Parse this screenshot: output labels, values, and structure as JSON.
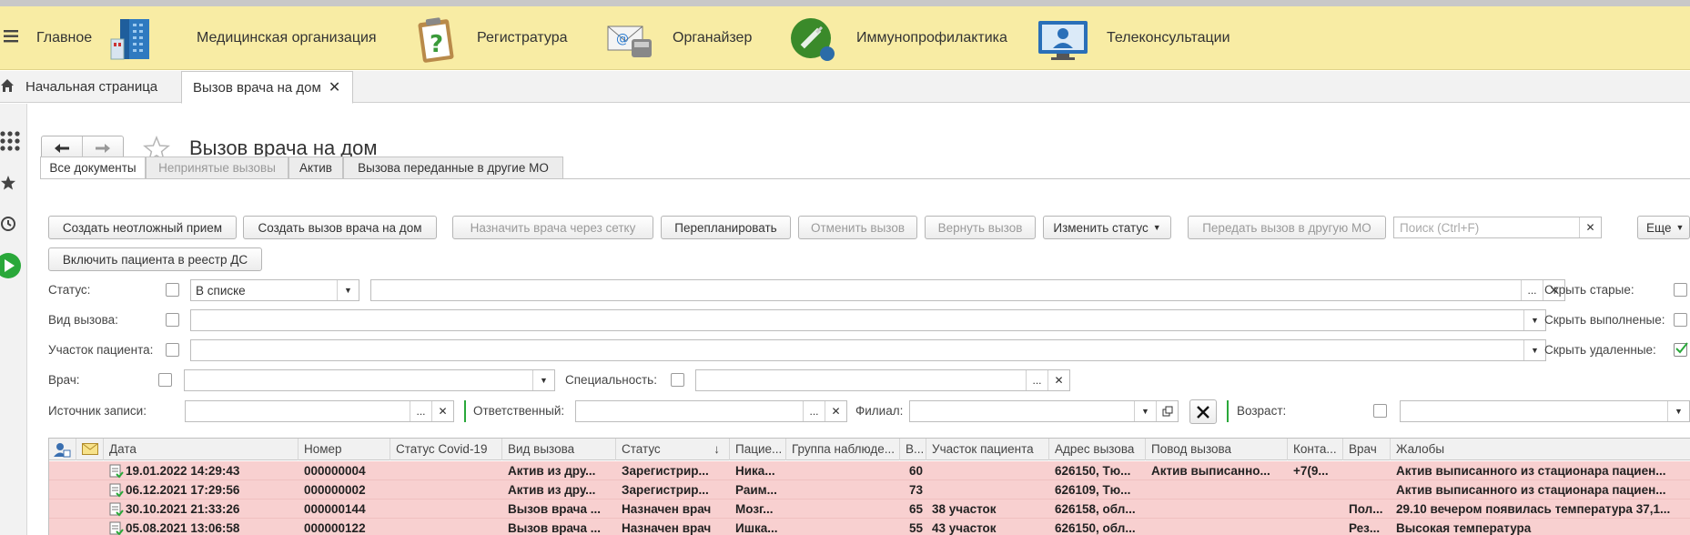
{
  "nav": {
    "items": [
      {
        "label": "Главное",
        "icon": "menu-icon"
      },
      {
        "label": "Медицинская организация",
        "icon": "hospital-building-icon"
      },
      {
        "label": "Регистратура",
        "icon": "clipboard-question-icon"
      },
      {
        "label": "Органайзер",
        "icon": "mail-phone-icon"
      },
      {
        "label": "Иммунопрофилактика",
        "icon": "syringe-icon"
      },
      {
        "label": "Телеконсультации",
        "icon": "operator-monitor-icon"
      }
    ]
  },
  "page_tabs": [
    {
      "label": "Начальная страница",
      "icon": "home-icon"
    },
    {
      "label": "Вызов врача на дом",
      "active": true
    }
  ],
  "form": {
    "title": "Вызов врача на дом",
    "filter_tabs": [
      "Все документы",
      "Непринятые вызовы",
      "Актив",
      "Вызова переданные в другие МО"
    ],
    "toolbar": {
      "create_urgent": "Создать неотложный прием",
      "create_home_call": "Создать вызов врача на дом",
      "assign_doctor": "Назначить врача через сетку",
      "reschedule": "Перепланировать",
      "cancel_call": "Отменить вызов",
      "return_call": "Вернуть вызов",
      "change_status": "Изменить статус",
      "transfer": "Передать вызов в другую МО",
      "search_placeholder": "Поиск (Ctrl+F)",
      "more": "Еще",
      "include_registry": "Включить пациента в реестр ДС"
    },
    "filters": {
      "status_label": "Статус:",
      "status_mode": "В списке",
      "call_type_label": "Вид вызова:",
      "district_label": "Участок пациента:",
      "doctor_label": "Врач:",
      "specialty_label": "Специальность:",
      "source_label": "Источник записи:",
      "responsible_label": "Ответственный:",
      "branch_label": "Филиал:",
      "age_label": "Возраст:",
      "hide_old": "Скрыть старые:",
      "hide_done": "Скрыть выполненые:",
      "hide_deleted": "Скрыть удаленные:",
      "hide_deleted_checked": true
    }
  },
  "table": {
    "columns": [
      "Дата",
      "Номер",
      "Статус Covid-19",
      "Вид вызова",
      "Статус",
      "Пацие...",
      "Группа наблюде...",
      "В...",
      "Участок пациента",
      "Адрес вызова",
      "Повод вызова",
      "Конта...",
      "Врач",
      "Жалобы"
    ],
    "rows": [
      {
        "date": "19.01.2022 14:29:43",
        "number": "000000004",
        "covid": "",
        "type": "Актив из дру...",
        "status": "Зарегистрир...",
        "patient": "Ника...",
        "group": "",
        "age": "60",
        "district": "",
        "address": "626150, Тю...",
        "reason": "Актив выписанно...",
        "contact": "+7(9...",
        "doctor": "",
        "complaint": "Актив выписанного из стационара пациен..."
      },
      {
        "date": "06.12.2021 17:29:56",
        "number": "000000002",
        "covid": "",
        "type": "Актив из дру...",
        "status": "Зарегистрир...",
        "patient": "Раим...",
        "group": "",
        "age": "73",
        "district": "",
        "address": "626109, Тю...",
        "reason": "",
        "contact": "",
        "doctor": "",
        "complaint": "Актив выписанного из стационара пациен..."
      },
      {
        "date": "30.10.2021 21:33:26",
        "number": "000000144",
        "covid": "",
        "type": "Вызов врача ...",
        "status": "Назначен врач",
        "patient": "Мозг...",
        "group": "",
        "age": "65",
        "district": "38 участок",
        "address": "626158, обл...",
        "reason": "",
        "contact": "",
        "doctor": "Пол...",
        "complaint": "29.10 вечером появилась температура 37,1..."
      },
      {
        "date": "05.08.2021 13:06:58",
        "number": "000000122",
        "covid": "",
        "type": "Вызов врача ...",
        "status": "Назначен врач",
        "patient": "Ишка...",
        "group": "",
        "age": "55",
        "district": "43 участок",
        "address": "626150, обл...",
        "reason": "",
        "contact": "",
        "doctor": "Рез...",
        "complaint": "Высокая температура"
      }
    ]
  }
}
